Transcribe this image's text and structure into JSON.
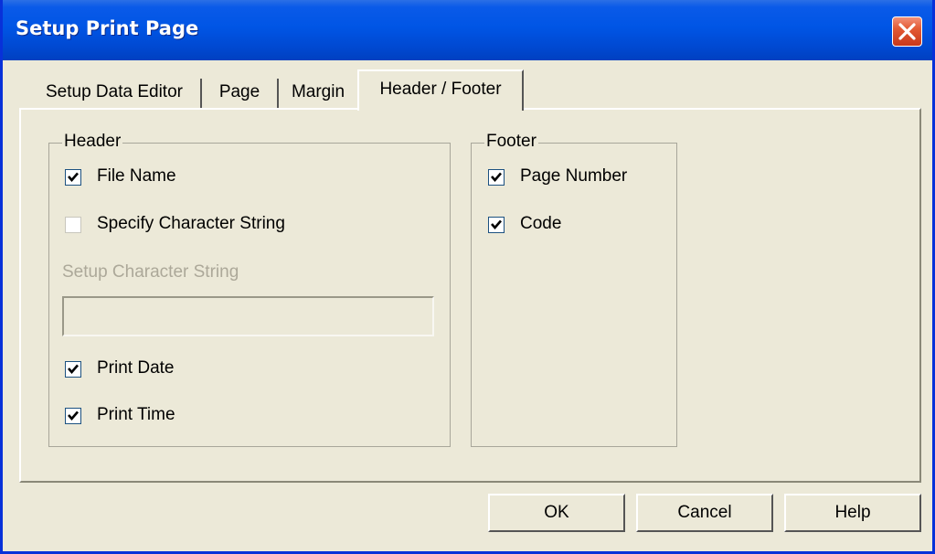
{
  "window": {
    "title": "Setup Print Page"
  },
  "tabs": [
    {
      "label": "Setup Data Editor",
      "active": false
    },
    {
      "label": "Page",
      "active": false
    },
    {
      "label": "Margin",
      "active": false
    },
    {
      "label": "Header / Footer",
      "active": true
    }
  ],
  "header": {
    "legend": "Header",
    "file_name": {
      "label": "File Name",
      "checked": true
    },
    "specify_string": {
      "label": "Specify Character String",
      "checked": false
    },
    "setup_string_label": "Setup Character String",
    "setup_string_value": "",
    "print_date": {
      "label": "Print Date",
      "checked": true
    },
    "print_time": {
      "label": "Print Time",
      "checked": true
    }
  },
  "footer": {
    "legend": "Footer",
    "page_number": {
      "label": "Page Number",
      "checked": true
    },
    "code": {
      "label": "Code",
      "checked": true
    }
  },
  "buttons": {
    "ok": "OK",
    "cancel": "Cancel",
    "help": "Help"
  },
  "icons": {
    "close": "close-icon",
    "check": "checkmark-icon"
  },
  "colors": {
    "titlebar": "#0055e5",
    "close_button": "#e35a34",
    "face": "#ece9d8",
    "disabled_text": "#aca899"
  }
}
